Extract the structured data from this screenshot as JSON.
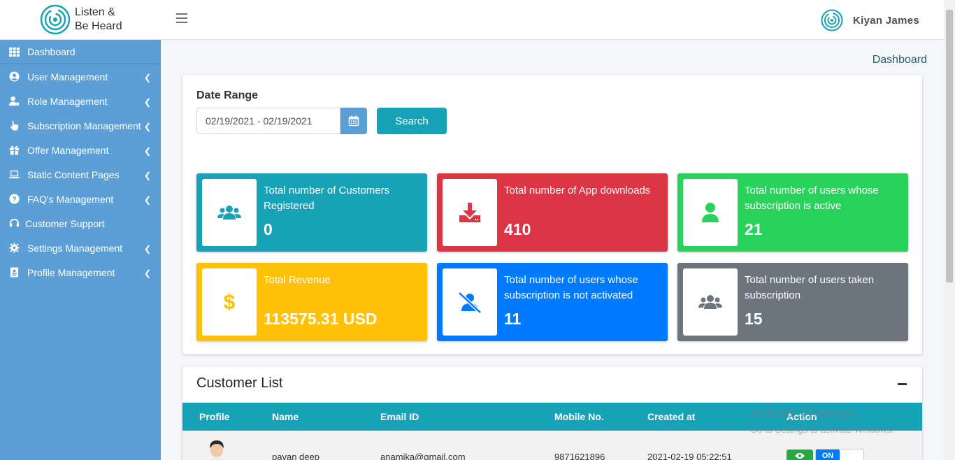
{
  "brand": {
    "line1": "Listen &",
    "line2": "Be Heard"
  },
  "sidebar": {
    "items": [
      {
        "label": "Dashboard",
        "icon": "grid-icon",
        "caret": false
      },
      {
        "label": "User Management",
        "icon": "user-circle-icon",
        "caret": true
      },
      {
        "label": "Role Management",
        "icon": "user-cog-icon",
        "caret": true
      },
      {
        "label": "Subscription Management",
        "icon": "hand-pointer-icon",
        "caret": true
      },
      {
        "label": "Offer Management",
        "icon": "gift-icon",
        "caret": true
      },
      {
        "label": "Static Content Pages",
        "icon": "laptop-icon",
        "caret": true
      },
      {
        "label": "FAQ's Management",
        "icon": "question-circle-icon",
        "caret": true
      },
      {
        "label": "Customer Support",
        "icon": "headset-icon",
        "caret": false
      },
      {
        "label": "Settings Management",
        "icon": "gear-icon",
        "caret": true
      },
      {
        "label": "Profile Management",
        "icon": "id-badge-icon",
        "caret": true
      }
    ]
  },
  "topbar": {
    "user_name": "Kiyan James"
  },
  "breadcrumb": "Dashboard",
  "filters": {
    "date_range_label": "Date Range",
    "date_range_value": "02/19/2021 - 02/19/2021",
    "search_label": "Search"
  },
  "stats": [
    {
      "label": "Total number of Customers Registered",
      "value": "0",
      "color": "#17a2b8",
      "icon": "users-icon"
    },
    {
      "label": "Total number of App downloads",
      "value": "410",
      "color": "#dc3545",
      "icon": "download-icon"
    },
    {
      "label": "Total number of users whose subscription is active",
      "value": "21",
      "color": "#28d25b",
      "icon": "user-icon"
    },
    {
      "label": "Total Revenue",
      "value": "113575.31 USD",
      "color": "#ffc107",
      "icon": "dollar-icon"
    },
    {
      "label": "Total number of users whose subscription is not activated",
      "value": "11",
      "color": "#007bff",
      "icon": "user-slash-icon"
    },
    {
      "label": "Total number of users taken subscription",
      "value": "15",
      "color": "#6c757d",
      "icon": "users-icon"
    }
  ],
  "customer_list": {
    "title": "Customer List",
    "columns": [
      "Profile",
      "Name",
      "Email ID",
      "Mobile No.",
      "Created at",
      "Action"
    ],
    "rows": [
      {
        "name": "pavan deep",
        "email": "anamika@gmail.com",
        "mobile": "9871621896",
        "created_at": "2021-02-19 05:22:51",
        "toggle": "ON"
      }
    ]
  },
  "watermark": {
    "line1": "Activate Windows",
    "line2": "Go to Settings to activate Windows."
  }
}
